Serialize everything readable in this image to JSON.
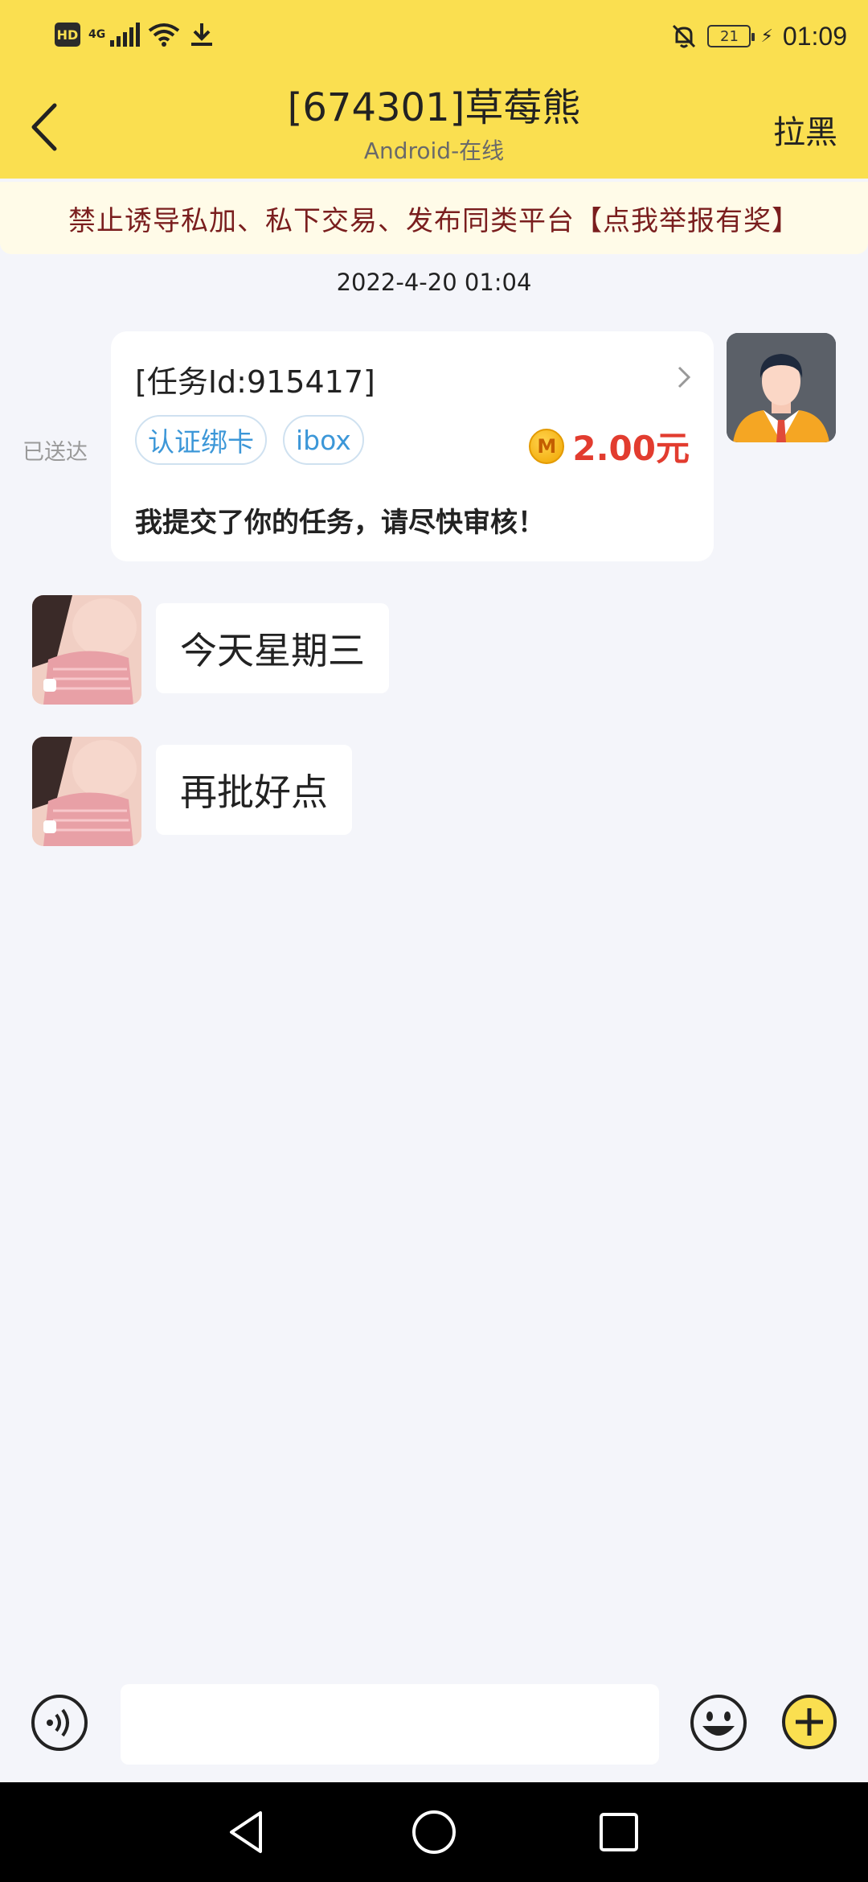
{
  "status_bar": {
    "hd": "HD",
    "network": "4G",
    "battery": "21",
    "time": "01:09"
  },
  "header": {
    "title": "[674301]草莓熊",
    "subtitle": "Android-在线",
    "block_label": "拉黑",
    "background_color": "#fadf50"
  },
  "banner": {
    "text": "禁止诱导私加、私下交易、发布同类平台【点我举报有奖】",
    "text_color": "#7a1e1e"
  },
  "chat": {
    "date": "2022-4-20 01:04",
    "sent_status": "已送达",
    "task_card": {
      "task_id": "[任务Id:915417]",
      "tags": [
        "认证绑卡",
        "ibox"
      ],
      "coin_letter": "M",
      "amount": "2.00元",
      "message": "我提交了你的任务，请尽快审核！",
      "amount_color": "#e23c2f"
    },
    "messages": [
      {
        "text": "今天星期三"
      },
      {
        "text": "再批好点"
      }
    ]
  },
  "input_bar": {
    "placeholder": ""
  }
}
